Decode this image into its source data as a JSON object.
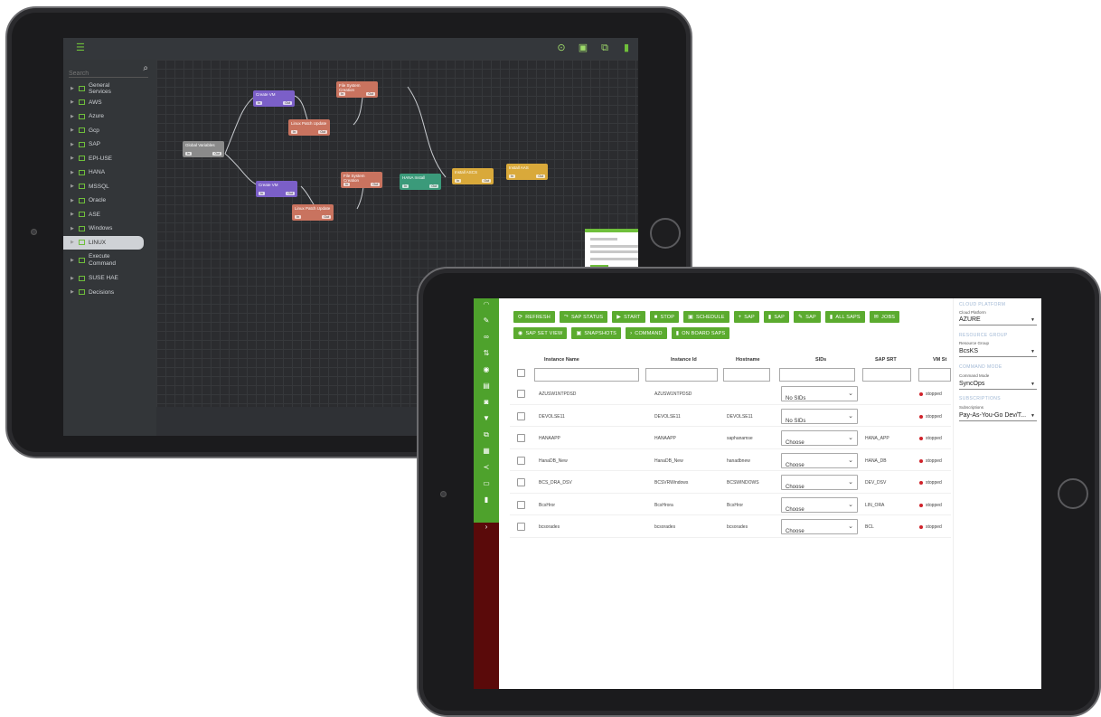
{
  "top_tablet": {
    "search_placeholder": "Search",
    "tree": [
      {
        "label": "General Services"
      },
      {
        "label": "AWS"
      },
      {
        "label": "Azure"
      },
      {
        "label": "Gcp"
      },
      {
        "label": "SAP"
      },
      {
        "label": "EPI-USE"
      },
      {
        "label": "HANA"
      },
      {
        "label": "MSSQL"
      },
      {
        "label": "Oracle"
      },
      {
        "label": "ASE"
      },
      {
        "label": "Windows"
      },
      {
        "label": "LINUX"
      },
      {
        "label": "Execute Command"
      },
      {
        "label": "SUSE HAE"
      },
      {
        "label": "Decisions"
      }
    ],
    "nodes": [
      {
        "label": "Create VM",
        "color": "#7b5fc8",
        "pin_in": "In",
        "pin_out": "Out"
      },
      {
        "label": "File System Creation",
        "color": "#c9735f",
        "pin_in": "In",
        "pin_out": "Out"
      },
      {
        "label": "Linux Patch Update",
        "color": "#c9735f",
        "pin_in": "In",
        "pin_out": "Out"
      },
      {
        "label": "Global Variables",
        "color": "#8a8a8a",
        "pin_in": "In",
        "pin_out": "Out"
      },
      {
        "label": "Create VM",
        "color": "#7b5fc8",
        "pin_in": "In",
        "pin_out": "Out"
      },
      {
        "label": "File System Creation",
        "color": "#c9735f",
        "pin_in": "In",
        "pin_out": "Out"
      },
      {
        "label": "HANA Install",
        "color": "#3b9a7a",
        "pin_in": "In",
        "pin_out": "Out"
      },
      {
        "label": "Install ASCS",
        "color": "#d9a93a",
        "pin_in": "In",
        "pin_out": "Out"
      },
      {
        "label": "Install AAS",
        "color": "#d9a93a",
        "pin_in": "In",
        "pin_out": "Out"
      },
      {
        "label": "Linux Patch Update",
        "color": "#c9735f",
        "pin_in": "In",
        "pin_out": "Out"
      }
    ]
  },
  "bottom_tablet": {
    "toolbar_row1": [
      "REFRESH",
      "SAP STATUS",
      "START",
      "STOP",
      "SCHEDULE",
      "SAP",
      "SAP",
      "SAP",
      "ALL SAPS",
      "JOBS"
    ],
    "toolbar_row2": [
      "SAP SET VIEW",
      "SNAPSHOTS",
      "COMMAND",
      "ON BOARD SAPS"
    ],
    "columns": [
      "Instance Name",
      "Instance Id",
      "Hostname",
      "SIDs",
      "SAP SRT",
      "VM St"
    ],
    "rows": [
      {
        "name": "AZUSW1NTPDSD",
        "id": "AZUSW1NTPDSD",
        "host": "",
        "sids": "No SIDs",
        "srt": "",
        "status": "stopped"
      },
      {
        "name": "DEVOLSE11",
        "id": "DEVOLSE11",
        "host": "DEVOLSE11",
        "sids": "No SIDs",
        "srt": "",
        "status": "stopped"
      },
      {
        "name": "HANAAPP",
        "id": "HANAAPP",
        "host": "saphanamse",
        "sids": "Choose",
        "srt": "HANA_APP",
        "status": "stopped"
      },
      {
        "name": "HanaDB_New",
        "id": "HanaDB_New",
        "host": "hanadbnew",
        "sids": "Choose",
        "srt": "HANA_DB",
        "status": "stopped"
      },
      {
        "name": "BCS_DRA_DSV",
        "id": "BCSVRWindows",
        "host": "BCSWINDOWS",
        "sids": "Choose",
        "srt": "DEV_DSV",
        "status": "stopped"
      },
      {
        "name": "BcsHror",
        "id": "BcsHrora",
        "host": "BcsHror",
        "sids": "Choose",
        "srt": "LIN_ORA",
        "status": "stopped"
      },
      {
        "name": "bcsorades",
        "id": "bcsorades",
        "host": "bcsorades",
        "sids": "Choose",
        "srt": "BCL",
        "status": "stopped"
      }
    ],
    "right_panel": {
      "cloud_platform_header": "CLOUD PLATFORM",
      "cloud_platform_label": "Cloud Platform",
      "cloud_platform_value": "AZURE",
      "resource_group_header": "RESOURCE GROUP",
      "resource_group_label": "Resource Group",
      "resource_group_value": "BcsKS",
      "command_mode_header": "COMMAND MODE",
      "command_mode_label": "Command Mode",
      "command_mode_value": "SyncOps",
      "subscriptions_header": "SUBSCRIPTIONS",
      "subscriptions_label": "Subscriptions",
      "subscriptions_value": "Pay-As-You-Go Dev/T..."
    },
    "accent_color": "#5bab2f",
    "status_color": "#d0222a"
  }
}
